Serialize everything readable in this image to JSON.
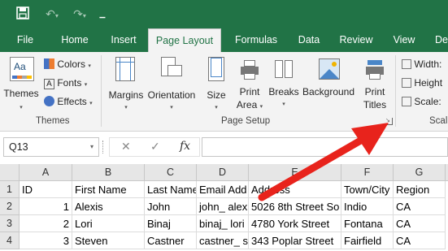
{
  "titlebar": {
    "save_icon": "save-icon",
    "undo_icon": "undo-icon",
    "redo_icon": "redo-icon",
    "customize_icon": "customize-quick-access-icon"
  },
  "tabs": [
    "File",
    "Home",
    "Insert",
    "Page Layout",
    "Formulas",
    "Data",
    "Review",
    "View",
    "De"
  ],
  "active_tab": "Page Layout",
  "ribbon": {
    "themes": {
      "label": "Themes",
      "colors": "Colors",
      "fonts": "Fonts",
      "effects": "Effects",
      "group": "Themes"
    },
    "page_setup": {
      "margins": "Margins",
      "orientation": "Orientation",
      "size": "Size",
      "print_area_1": "Print",
      "print_area_2": "Area",
      "breaks": "Breaks",
      "background": "Background",
      "print_titles_1": "Print",
      "print_titles_2": "Titles",
      "group": "Page Setup"
    },
    "scale": {
      "width": "Width:",
      "height": "Height",
      "scale": "Scale:",
      "group": "Scal"
    }
  },
  "formula_bar": {
    "name_box": "Q13",
    "fx": "fx",
    "cancel": "✕",
    "enter": "✓",
    "value": ""
  },
  "grid": {
    "columns": [
      "A",
      "B",
      "C",
      "D",
      "E",
      "F",
      "G"
    ],
    "rows": [
      "1",
      "2",
      "3",
      "4"
    ],
    "data": [
      [
        "ID",
        "First Name",
        "Last Name",
        "Email Add",
        "Address",
        "Town/City",
        "Region"
      ],
      [
        "1",
        "Alexis",
        "John",
        "john_ alex",
        "5026 8th Street So",
        "Indio",
        "CA"
      ],
      [
        "2",
        "Lori",
        "Binaj",
        "binaj_ lori",
        "4780 York Street",
        "Fontana",
        "CA"
      ],
      [
        "3",
        "Steven",
        "Castner",
        "castner_ s",
        "343 Poplar Street",
        "Fairfield",
        "CA"
      ]
    ]
  },
  "colors": {
    "excel_green": "#217346",
    "arrow_red": "#e8231c"
  }
}
